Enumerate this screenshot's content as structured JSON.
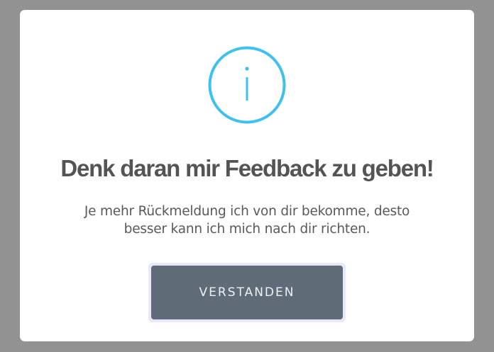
{
  "dialog": {
    "icon": "info-circle-icon",
    "title": "Denk daran mir Feedback zu geben!",
    "message": "Je mehr Rückmeldung ich von dir bekomme, desto besser kann ich mich nach dir richten.",
    "confirm_label": "VERSTANDEN"
  },
  "colors": {
    "overlay": "#929292",
    "accent": "#3ec1ea",
    "button": "#5f6b77",
    "title": "#545454"
  }
}
